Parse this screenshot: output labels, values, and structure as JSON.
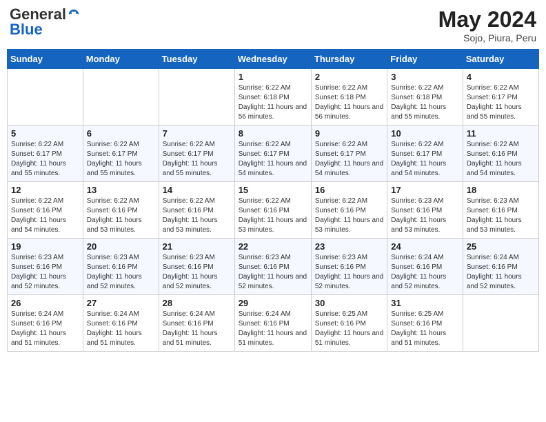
{
  "header": {
    "logo_general": "General",
    "logo_blue": "Blue",
    "month_year": "May 2024",
    "location": "Sojo, Piura, Peru"
  },
  "weekdays": [
    "Sunday",
    "Monday",
    "Tuesday",
    "Wednesday",
    "Thursday",
    "Friday",
    "Saturday"
  ],
  "weeks": [
    [
      {
        "day": "",
        "info": ""
      },
      {
        "day": "",
        "info": ""
      },
      {
        "day": "",
        "info": ""
      },
      {
        "day": "1",
        "info": "Sunrise: 6:22 AM\nSunset: 6:18 PM\nDaylight: 11 hours and 56 minutes."
      },
      {
        "day": "2",
        "info": "Sunrise: 6:22 AM\nSunset: 6:18 PM\nDaylight: 11 hours and 56 minutes."
      },
      {
        "day": "3",
        "info": "Sunrise: 6:22 AM\nSunset: 6:18 PM\nDaylight: 11 hours and 55 minutes."
      },
      {
        "day": "4",
        "info": "Sunrise: 6:22 AM\nSunset: 6:17 PM\nDaylight: 11 hours and 55 minutes."
      }
    ],
    [
      {
        "day": "5",
        "info": "Sunrise: 6:22 AM\nSunset: 6:17 PM\nDaylight: 11 hours and 55 minutes."
      },
      {
        "day": "6",
        "info": "Sunrise: 6:22 AM\nSunset: 6:17 PM\nDaylight: 11 hours and 55 minutes."
      },
      {
        "day": "7",
        "info": "Sunrise: 6:22 AM\nSunset: 6:17 PM\nDaylight: 11 hours and 55 minutes."
      },
      {
        "day": "8",
        "info": "Sunrise: 6:22 AM\nSunset: 6:17 PM\nDaylight: 11 hours and 54 minutes."
      },
      {
        "day": "9",
        "info": "Sunrise: 6:22 AM\nSunset: 6:17 PM\nDaylight: 11 hours and 54 minutes."
      },
      {
        "day": "10",
        "info": "Sunrise: 6:22 AM\nSunset: 6:17 PM\nDaylight: 11 hours and 54 minutes."
      },
      {
        "day": "11",
        "info": "Sunrise: 6:22 AM\nSunset: 6:16 PM\nDaylight: 11 hours and 54 minutes."
      }
    ],
    [
      {
        "day": "12",
        "info": "Sunrise: 6:22 AM\nSunset: 6:16 PM\nDaylight: 11 hours and 54 minutes."
      },
      {
        "day": "13",
        "info": "Sunrise: 6:22 AM\nSunset: 6:16 PM\nDaylight: 11 hours and 53 minutes."
      },
      {
        "day": "14",
        "info": "Sunrise: 6:22 AM\nSunset: 6:16 PM\nDaylight: 11 hours and 53 minutes."
      },
      {
        "day": "15",
        "info": "Sunrise: 6:22 AM\nSunset: 6:16 PM\nDaylight: 11 hours and 53 minutes."
      },
      {
        "day": "16",
        "info": "Sunrise: 6:22 AM\nSunset: 6:16 PM\nDaylight: 11 hours and 53 minutes."
      },
      {
        "day": "17",
        "info": "Sunrise: 6:23 AM\nSunset: 6:16 PM\nDaylight: 11 hours and 53 minutes."
      },
      {
        "day": "18",
        "info": "Sunrise: 6:23 AM\nSunset: 6:16 PM\nDaylight: 11 hours and 53 minutes."
      }
    ],
    [
      {
        "day": "19",
        "info": "Sunrise: 6:23 AM\nSunset: 6:16 PM\nDaylight: 11 hours and 52 minutes."
      },
      {
        "day": "20",
        "info": "Sunrise: 6:23 AM\nSunset: 6:16 PM\nDaylight: 11 hours and 52 minutes."
      },
      {
        "day": "21",
        "info": "Sunrise: 6:23 AM\nSunset: 6:16 PM\nDaylight: 11 hours and 52 minutes."
      },
      {
        "day": "22",
        "info": "Sunrise: 6:23 AM\nSunset: 6:16 PM\nDaylight: 11 hours and 52 minutes."
      },
      {
        "day": "23",
        "info": "Sunrise: 6:23 AM\nSunset: 6:16 PM\nDaylight: 11 hours and 52 minutes."
      },
      {
        "day": "24",
        "info": "Sunrise: 6:24 AM\nSunset: 6:16 PM\nDaylight: 11 hours and 52 minutes."
      },
      {
        "day": "25",
        "info": "Sunrise: 6:24 AM\nSunset: 6:16 PM\nDaylight: 11 hours and 52 minutes."
      }
    ],
    [
      {
        "day": "26",
        "info": "Sunrise: 6:24 AM\nSunset: 6:16 PM\nDaylight: 11 hours and 51 minutes."
      },
      {
        "day": "27",
        "info": "Sunrise: 6:24 AM\nSunset: 6:16 PM\nDaylight: 11 hours and 51 minutes."
      },
      {
        "day": "28",
        "info": "Sunrise: 6:24 AM\nSunset: 6:16 PM\nDaylight: 11 hours and 51 minutes."
      },
      {
        "day": "29",
        "info": "Sunrise: 6:24 AM\nSunset: 6:16 PM\nDaylight: 11 hours and 51 minutes."
      },
      {
        "day": "30",
        "info": "Sunrise: 6:25 AM\nSunset: 6:16 PM\nDaylight: 11 hours and 51 minutes."
      },
      {
        "day": "31",
        "info": "Sunrise: 6:25 AM\nSunset: 6:16 PM\nDaylight: 11 hours and 51 minutes."
      },
      {
        "day": "",
        "info": ""
      }
    ]
  ]
}
